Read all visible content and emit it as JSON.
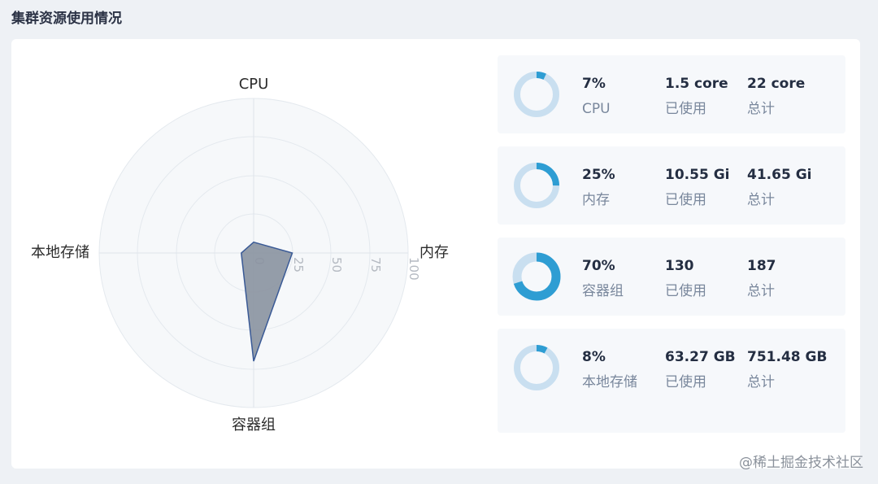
{
  "header": {
    "title": "集群资源使用情况"
  },
  "radar": {
    "axes": [
      "CPU",
      "内存",
      "容器组",
      "本地存储"
    ],
    "ticks": [
      "0",
      "25",
      "50",
      "75",
      "100"
    ],
    "values": {
      "CPU": 7,
      "内存": 25,
      "容器组": 70,
      "本地存储": 8
    },
    "range": [
      0,
      100
    ]
  },
  "stats": [
    {
      "percent": "7%",
      "percent_value": 7,
      "name": "CPU",
      "used": "1.5 core",
      "used_label": "已使用",
      "total": "22 core",
      "total_label": "总计"
    },
    {
      "percent": "25%",
      "percent_value": 25,
      "name": "内存",
      "used": "10.55 Gi",
      "used_label": "已使用",
      "total": "41.65 Gi",
      "total_label": "总计"
    },
    {
      "percent": "70%",
      "percent_value": 70,
      "name": "容器组",
      "used": "130",
      "used_label": "已使用",
      "total": "187",
      "total_label": "总计"
    },
    {
      "percent": "8%",
      "percent_value": 8,
      "name": "本地存储",
      "used": "63.27 GB",
      "used_label": "已使用",
      "total": "751.48 GB",
      "total_label": "总计"
    }
  ],
  "colors": {
    "accent": "#2e9dd3",
    "track": "#c9dff0",
    "polygon": "#8a92a0"
  },
  "watermark": "@稀土掘金技术社区"
}
